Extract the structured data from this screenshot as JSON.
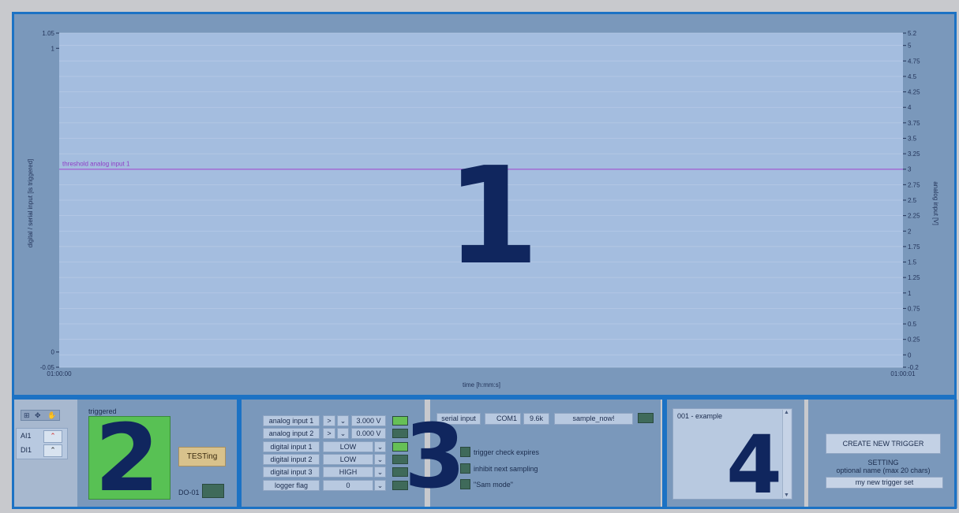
{
  "chart": {
    "left_axis_label": "digital / serial input [is triggered]",
    "right_axis_label": "analog input [V]",
    "x_axis_label": "time [h:mm:s]",
    "left_ticks": [
      "1.05",
      "1",
      "0",
      "-0.05"
    ],
    "right_ticks": [
      "5.2",
      "5",
      "4.75",
      "4.5",
      "4.25",
      "4",
      "3.75",
      "3.5",
      "3.25",
      "3",
      "2.75",
      "2.5",
      "2.25",
      "2",
      "1.75",
      "1.5",
      "1.25",
      "1",
      "0.75",
      "0.5",
      "0.25",
      "0",
      "-0.2"
    ],
    "x_ticks": [
      "01:00:00",
      "01:00:01"
    ],
    "threshold_label": "threshold analog input 1",
    "threshold_value": 3
  },
  "chart_data": {
    "type": "line",
    "x": [
      "01:00:00",
      "01:00:01"
    ],
    "series": [
      {
        "name": "threshold analog input 1",
        "values": [
          3,
          3
        ]
      }
    ],
    "xlabel": "time [h:mm:s]",
    "ylabel": "digital / serial input [is triggered]",
    "y2label": "analog input [V]",
    "ylim": [
      -0.05,
      1.05
    ],
    "y2lim": [
      -0.2,
      5.2
    ],
    "grid": true
  },
  "overlay_numbers": [
    "1",
    "2",
    "3",
    "4"
  ],
  "panel2": {
    "legend_items": [
      "AI1",
      "DI1"
    ],
    "triggered_label": "triggered",
    "testing_button": "TESTing",
    "do_label": "DO-01"
  },
  "panel3": {
    "rows": [
      {
        "label": "analog input 1",
        "op": ">",
        "value": "3.000 V",
        "led_on": true
      },
      {
        "label": "analog input 2",
        "op": ">",
        "value": "0.000 V",
        "led_on": false
      },
      {
        "label": "digital input 1",
        "value": "LOW",
        "led_on": true
      },
      {
        "label": "digital input 2",
        "value": "LOW",
        "led_on": false
      },
      {
        "label": "digital input 3",
        "value": "HIGH",
        "led_on": false
      },
      {
        "label": "logger flag",
        "value": "0",
        "led_on": false
      }
    ],
    "serial_input_label": "serial input",
    "com_port": "COM1",
    "baud": "9.6k",
    "serial_command": "sample_now!",
    "options": [
      "trigger check expires",
      "inhibit next sampling",
      "\"Sam mode\""
    ]
  },
  "panel4": {
    "list_items": [
      "001 - example"
    ],
    "create_button": "CREATE NEW TRIGGER SETTING",
    "name_label": "optional name (max 20 chars)",
    "name_value": "my new trigger set"
  },
  "colors": {
    "region_border": "#1c72c4",
    "overlay_number": "#10265e",
    "threshold_line": "#a25bd0",
    "led_on": "#66c056",
    "led_off": "#3f6a5a",
    "triggered_indicator": "#58c154"
  }
}
